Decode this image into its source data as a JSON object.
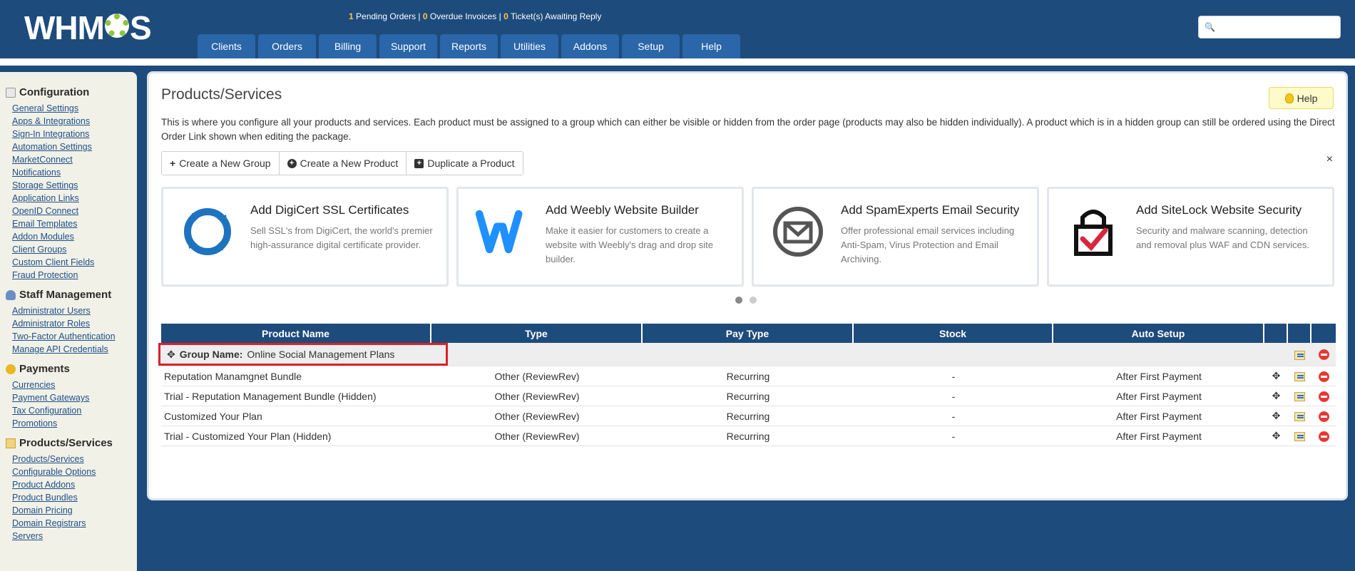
{
  "header": {
    "logo_text_left": "WHM",
    "logo_text_right": "S",
    "alerts": {
      "pending_count": "1",
      "pending_label": "Pending Orders",
      "overdue_count": "0",
      "overdue_label": "Overdue Invoices",
      "tickets_count": "0",
      "tickets_label": "Ticket(s) Awaiting Reply",
      "separator": "|"
    },
    "nav": [
      "Clients",
      "Orders",
      "Billing",
      "Support",
      "Reports",
      "Utilities",
      "Addons",
      "Setup",
      "Help"
    ],
    "search_placeholder": ""
  },
  "sidebar": {
    "sections": [
      {
        "title": "Configuration",
        "icon": "config-icon",
        "links": [
          "General Settings",
          "Apps & Integrations",
          "Sign-In Integrations",
          "Automation Settings",
          "MarketConnect",
          "Notifications",
          "Storage Settings",
          "Application Links",
          "OpenID Connect",
          "Email Templates",
          "Addon Modules",
          "Client Groups",
          "Custom Client Fields",
          "Fraud Protection"
        ]
      },
      {
        "title": "Staff Management",
        "icon": "staff-icon",
        "links": [
          "Administrator Users",
          "Administrator Roles",
          "Two-Factor Authentication",
          "Manage API Credentials"
        ]
      },
      {
        "title": "Payments",
        "icon": "payments-icon",
        "links": [
          "Currencies",
          "Payment Gateways",
          "Tax Configuration",
          "Promotions"
        ]
      },
      {
        "title": "Products/Services",
        "icon": "products-icon",
        "links": [
          "Products/Services",
          "Configurable Options",
          "Product Addons",
          "Product Bundles",
          "Domain Pricing",
          "Domain Registrars",
          "Servers"
        ]
      }
    ]
  },
  "main": {
    "title": "Products/Services",
    "help_label": "Help",
    "description": "This is where you configure all your products and services. Each product must be assigned to a group which can either be visible or hidden from the order page (products may also be hidden individually). A product which is in a hidden group can still be ordered using the Direct Order Link shown when editing the package.",
    "buttons": {
      "create_group": "Create a New Group",
      "create_product": "Create a New Product",
      "duplicate_product": "Duplicate a Product"
    },
    "close_glyph": "×",
    "cards": [
      {
        "title": "Add DigiCert SSL Certificates",
        "text": "Sell SSL's from DigiCert, the world's premier high-assurance digital certificate provider.",
        "icon": "digicert-logo-icon"
      },
      {
        "title": "Add Weebly Website Builder",
        "text": "Make it easier for customers to create a website with Weebly's drag and drop site builder.",
        "icon": "weebly-logo-icon"
      },
      {
        "title": "Add SpamExperts Email Security",
        "text": "Offer professional email services including Anti-Spam, Virus Protection and Email Archiving.",
        "icon": "spamexperts-logo-icon"
      },
      {
        "title": "Add SiteLock Website Security",
        "text": "Security and malware scanning, detection and removal plus WAF and CDN services.",
        "icon": "sitelock-logo-icon"
      }
    ],
    "table": {
      "headers": [
        "Product Name",
        "Type",
        "Pay Type",
        "Stock",
        "Auto Setup"
      ],
      "group_label": "Group Name:",
      "group_name": "Online Social Management Plans",
      "rows": [
        {
          "name": "Reputation Manamgnet Bundle",
          "type": "Other (ReviewRev)",
          "pay_type": "Recurring",
          "stock": "-",
          "auto_setup": "After First Payment"
        },
        {
          "name": "Trial - Reputation Management Bundle (Hidden)",
          "type": "Other (ReviewRev)",
          "pay_type": "Recurring",
          "stock": "-",
          "auto_setup": "After First Payment"
        },
        {
          "name": "Customized Your Plan",
          "type": "Other (ReviewRev)",
          "pay_type": "Recurring",
          "stock": "-",
          "auto_setup": "After First Payment"
        },
        {
          "name": "Trial - Customized Your Plan (Hidden)",
          "type": "Other (ReviewRev)",
          "pay_type": "Recurring",
          "stock": "-",
          "auto_setup": "After First Payment"
        }
      ]
    }
  },
  "colors": {
    "header_bg": "#1d4b7c",
    "nav_tab": "#2a66a8",
    "accent_green": "#8cc63f",
    "alert_count": "#f7c948",
    "highlight_border": "#d9222a"
  }
}
